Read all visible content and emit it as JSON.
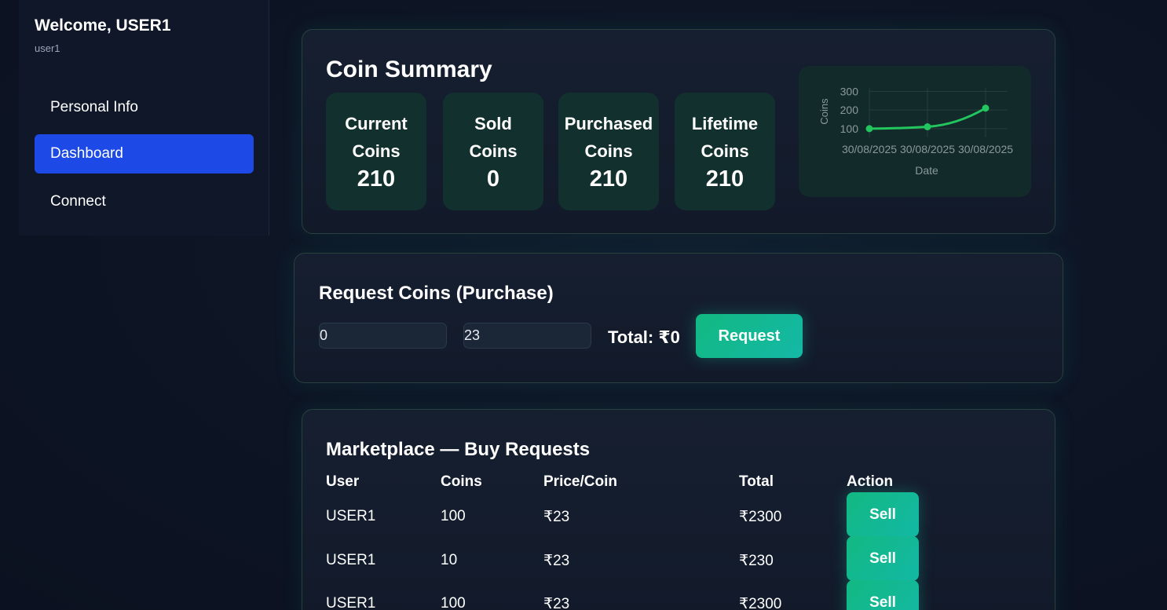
{
  "sidebar": {
    "welcome": "Welcome, USER1",
    "username": "user1",
    "items": [
      {
        "label": "Personal Info",
        "active": false
      },
      {
        "label": "Dashboard",
        "active": true
      },
      {
        "label": "Connect",
        "active": false
      }
    ]
  },
  "summary": {
    "title": "Coin Summary",
    "stats": [
      {
        "label": "Current\nCoins",
        "value": "210"
      },
      {
        "label": "Sold\nCoins",
        "value": "0"
      },
      {
        "label": "Purchased\nCoins",
        "value": "210"
      },
      {
        "label": "Lifetime\nCoins",
        "value": "210"
      }
    ]
  },
  "chart_data": {
    "type": "line",
    "x": [
      "30/08/2025",
      "30/08/2025",
      "30/08/2025"
    ],
    "series": [
      {
        "values": [
          100,
          110,
          210
        ],
        "color": "#22c55e"
      }
    ],
    "xlabel": "Date",
    "ylabel": "Coins",
    "yticks": [
      100,
      200,
      300
    ],
    "ylim": [
      70,
      310
    ],
    "grid": true
  },
  "request": {
    "title": "Request Coins (Purchase)",
    "coins_value": "0",
    "price_value": "23",
    "total": "Total: ₹0",
    "button": "Request"
  },
  "marketplace": {
    "title": "Marketplace — Buy Requests",
    "columns": [
      "User",
      "Coins",
      "Price/Coin",
      "Total",
      "Action"
    ],
    "rows": [
      {
        "user": "USER1",
        "coins": "100",
        "price": "₹23",
        "total": "₹2300",
        "action": "Sell"
      },
      {
        "user": "USER1",
        "coins": "10",
        "price": "₹23",
        "total": "₹230",
        "action": "Sell"
      },
      {
        "user": "USER1",
        "coins": "100",
        "price": "₹23",
        "total": "₹2300",
        "action": "Sell"
      }
    ]
  },
  "colors": {
    "accent_blue": "#1d4ae6",
    "accent_green": "#12b981",
    "stat_box": "#12302d"
  }
}
